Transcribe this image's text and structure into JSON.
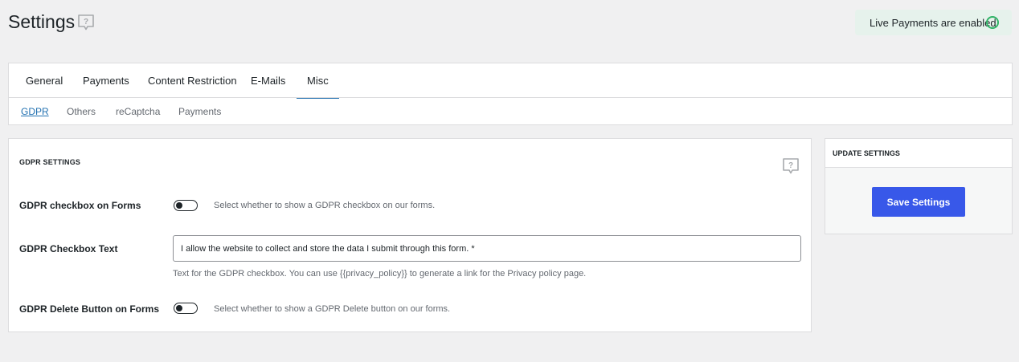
{
  "header": {
    "title": "Settings",
    "help_icon": "speech-bubble-question-icon",
    "live_status": "Live Payments are enabled",
    "live_color": "#2fb366"
  },
  "main_tabs": [
    {
      "label": "General",
      "active": false
    },
    {
      "label": "Payments",
      "active": false
    },
    {
      "label": "Content Restriction",
      "active": false
    },
    {
      "label": "E-Mails",
      "active": false
    },
    {
      "label": "Misc",
      "active": true
    }
  ],
  "sub_tabs": [
    {
      "label": "GDPR",
      "active": true
    },
    {
      "label": "Others",
      "active": false
    },
    {
      "label": "reCaptcha",
      "active": false
    },
    {
      "label": "Payments",
      "active": false
    }
  ],
  "gdpr": {
    "title": "GDPR SETTINGS",
    "help_icon": "speech-bubble-question-icon",
    "rows": {
      "checkbox_on_forms": {
        "label": "GDPR checkbox on Forms",
        "enabled": false,
        "description": "Select whether to show a GDPR checkbox on our forms."
      },
      "checkbox_text": {
        "label": "GDPR Checkbox Text",
        "value": "I allow the website to collect and store the data I submit through this form. *",
        "help": "Text for the GDPR checkbox. You can use {{privacy_policy}} to generate a link for the Privacy policy page."
      },
      "delete_button": {
        "label": "GDPR Delete Button on Forms",
        "enabled": false,
        "description": "Select whether to show a GDPR Delete button on our forms."
      }
    }
  },
  "update": {
    "title": "UPDATE SETTINGS",
    "save_label": "Save Settings",
    "button_color": "#3858e9"
  }
}
